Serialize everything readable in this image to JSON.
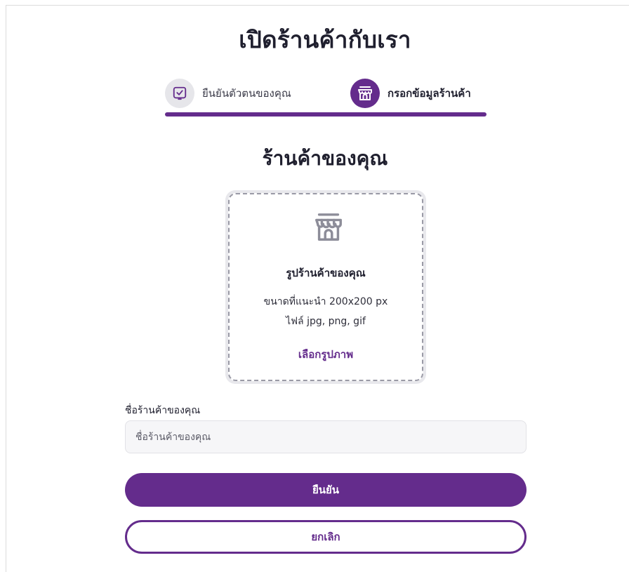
{
  "page": {
    "title": "เปิดร้านค้ากับเรา"
  },
  "stepper": {
    "steps": [
      {
        "label": "ยืนยันตัวตนของคุณ",
        "icon": "check-square-icon",
        "state": "completed"
      },
      {
        "label": "กรอกข้อมูลร้านค้า",
        "icon": "storefront-icon",
        "state": "active"
      }
    ],
    "progress_fraction": 1.0
  },
  "section": {
    "title": "ร้านค้าของคุณ"
  },
  "upload": {
    "icon": "storefront-icon",
    "title": "รูปร้านค้าของคุณ",
    "size_hint": "ขนาดที่แนะนำ 200x200 px",
    "types_hint": "ไฟล์ jpg, png, gif",
    "select_label": "เลือกรูปภาพ"
  },
  "form": {
    "shop_name_label": "ชื่อร้านค้าของคุณ",
    "shop_name_placeholder": "ชื่อร้านค้าของคุณ",
    "shop_name_value": ""
  },
  "actions": {
    "confirm_label": "ยืนยัน",
    "cancel_label": "ยกเลิก"
  },
  "colors": {
    "brand": "#642c8c",
    "inactive_step": "#e6e6ea",
    "input_bg": "#f6f6f8"
  }
}
